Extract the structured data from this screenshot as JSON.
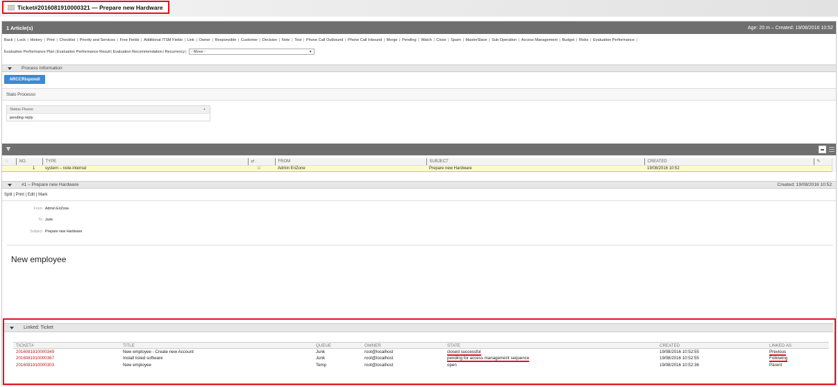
{
  "ticket": {
    "title": "Ticket#2016081910000321 — Prepare new Hardware"
  },
  "articles_bar": {
    "title": "1 Article(s)",
    "age": "Age: 20 m – Created: 19/08/2016 10:52"
  },
  "menu": {
    "row1": [
      "Back",
      "Lock",
      "History",
      "Print",
      "Checklist",
      "Priority and Services",
      "Free Fields",
      "Additional ITSM Fields",
      "Link",
      "Owner",
      "Responsible",
      "Customer",
      "Decision",
      "Note",
      "Test",
      "Phone Call Outbound",
      "Phone Call Inbound",
      "Merge",
      "Pending",
      "Watch",
      "Close",
      "Spam",
      "MasterSlave",
      "Sub Operation",
      "Access Management",
      "Budget",
      "Risks",
      "Evaluation Performance"
    ],
    "row2": [
      "Evaluation Performance Plan",
      "Evaluation Performance Result",
      "Evaluation Recommendation",
      "Recurrency"
    ],
    "move_select": "- Move -"
  },
  "process": {
    "section_title": "Process Information",
    "button_label": "ARCCRispondi",
    "stato_label": "Stato Processo",
    "status_flusso_label": "Status Flusso",
    "status_flusso_plus": "+",
    "status_flusso_value": "pending reply"
  },
  "article_table": {
    "headers": [
      "NO.",
      "TYPE",
      "⇄",
      "FROM",
      "SUBJECT",
      "CREATED",
      "✎"
    ],
    "rows": [
      {
        "no": "1",
        "type": "system – note-internal",
        "marker": "□",
        "from": "Admin EriZone",
        "subject": "Prepare new Hardware",
        "created": "19/08/2016 10:52"
      }
    ]
  },
  "article": {
    "header_title": "#1 – Prepare new Hardware",
    "created": "Created: 19/08/2016 10:52",
    "actions": [
      "Split",
      "Print",
      "Edit",
      "Mark"
    ],
    "from_label": "From:",
    "from_value": "Admin EriZone",
    "to_label": "To:",
    "to_value": "Junk",
    "subject_label": "Subject:",
    "subject_value": "Prepare new Hardware",
    "body": "New employee"
  },
  "linked": {
    "section_title": "Linked: Ticket",
    "headers": [
      "TICKET#",
      "TITLE",
      "QUEUE",
      "OWNER",
      "STATE",
      "CREATED",
      "LINKED AS"
    ],
    "rows": [
      {
        "ticket": "2016081910000349",
        "title": "New employee - Create new Account",
        "queue": "Junk",
        "owner": "root@localhost",
        "state": "closed successful",
        "created": "19/08/2016 10:52:55",
        "linked_as": "Previous"
      },
      {
        "ticket": "2016081910000367",
        "title": "Install listed software",
        "queue": "Junk",
        "owner": "root@localhost",
        "state": "pending for access management sequence",
        "created": "19/08/2016 10:52:55",
        "linked_as": "Following"
      },
      {
        "ticket": "2016081910000303",
        "title": "New employee",
        "queue": "Temp",
        "owner": "root@localhost",
        "state": "open",
        "created": "19/08/2016 10:52:36",
        "linked_as": "Parent"
      }
    ]
  },
  "colors": {
    "accent_red": "#e3101f",
    "button_blue": "#3c8ad1",
    "dark_bar": "#6f6f6f",
    "highlight_row": "#fbfbc7",
    "ticket_link": "#b01e1e"
  }
}
